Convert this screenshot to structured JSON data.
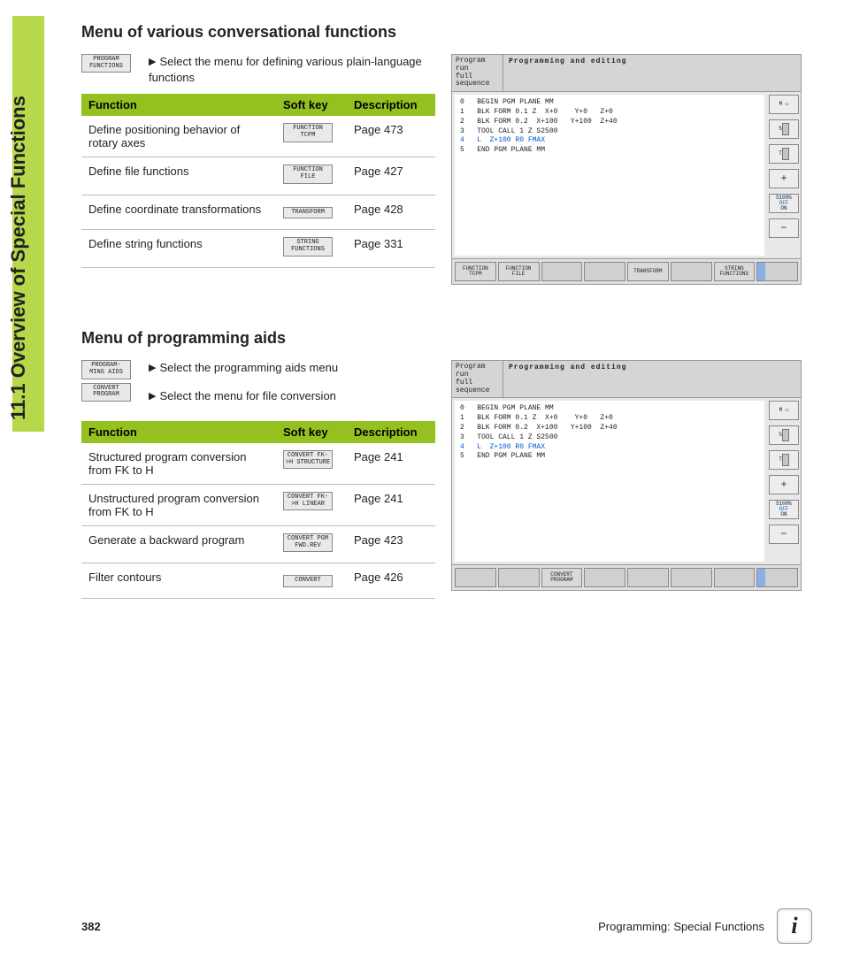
{
  "side_title": "11.1 Overview of Special Functions",
  "section1": {
    "heading": "Menu of various conversational functions",
    "intro_key": "PROGRAM FUNCTIONS",
    "intro_text": "Select the menu for defining various plain-language functions",
    "table": {
      "headers": [
        "Function",
        "Soft key",
        "Description"
      ],
      "rows": [
        {
          "fn": "Define positioning behavior of rotary axes",
          "key": "FUNCTION TCPM",
          "desc": "Page 473"
        },
        {
          "fn": "Define file functions",
          "key": "FUNCTION FILE",
          "desc": "Page 427"
        },
        {
          "fn": "Define coordinate transformations",
          "key": "TRANSFORM",
          "desc": "Page 428"
        },
        {
          "fn": "Define string functions",
          "key": "STRING FUNCTIONS",
          "desc": "Page 331"
        }
      ]
    }
  },
  "section2": {
    "heading": "Menu of programming aids",
    "intro_keys": [
      "PROGRAM- MING AIDS",
      "CONVERT PROGRAM"
    ],
    "intro_texts": [
      "Select the programming aids menu",
      "Select the menu for file conversion"
    ],
    "table": {
      "headers": [
        "Function",
        "Soft key",
        "Description"
      ],
      "rows": [
        {
          "fn": "Structured program conversion from FK to H",
          "key": "CONVERT FK->H STRUCTURE",
          "desc": "Page 241"
        },
        {
          "fn": "Unstructured program conversion from FK to H",
          "key": "CONVERT FK->H LINEAR",
          "desc": "Page 241"
        },
        {
          "fn": "Generate a backward program",
          "key": "CONVERT PGM FWD.REV",
          "desc": "Page 423"
        },
        {
          "fn": "Filter contours",
          "key": "CONVERT",
          "desc": "Page 426"
        }
      ]
    }
  },
  "screens": {
    "header_left": "Program run\nfull sequence",
    "header_right": "Programming and editing",
    "code_lines": [
      "0   BEGIN PGM PLANE MM",
      "1   BLK FORM 0.1 Z  X+0    Y+0   Z+0",
      "2   BLK FORM 0.2  X+100   Y+100  Z+40",
      "3   TOOL CALL 1 Z S2500",
      "4   L  Z+100 R0 FMAX",
      "5   END PGM PLANE MM"
    ],
    "side_labels": [
      "M",
      "S",
      "T",
      "",
      "S100%",
      "OFF  ON",
      ""
    ],
    "softkeys1": [
      "FUNCTION TCPM",
      "FUNCTION FILE",
      "",
      "",
      "TRANSFORM",
      "",
      "STRING FUNCTIONS",
      ""
    ],
    "softkeys2": [
      "",
      "",
      "CONVERT PROGRAM",
      "",
      "",
      "",
      "",
      ""
    ]
  },
  "footer": {
    "page": "382",
    "chapter": "Programming: Special Functions"
  }
}
